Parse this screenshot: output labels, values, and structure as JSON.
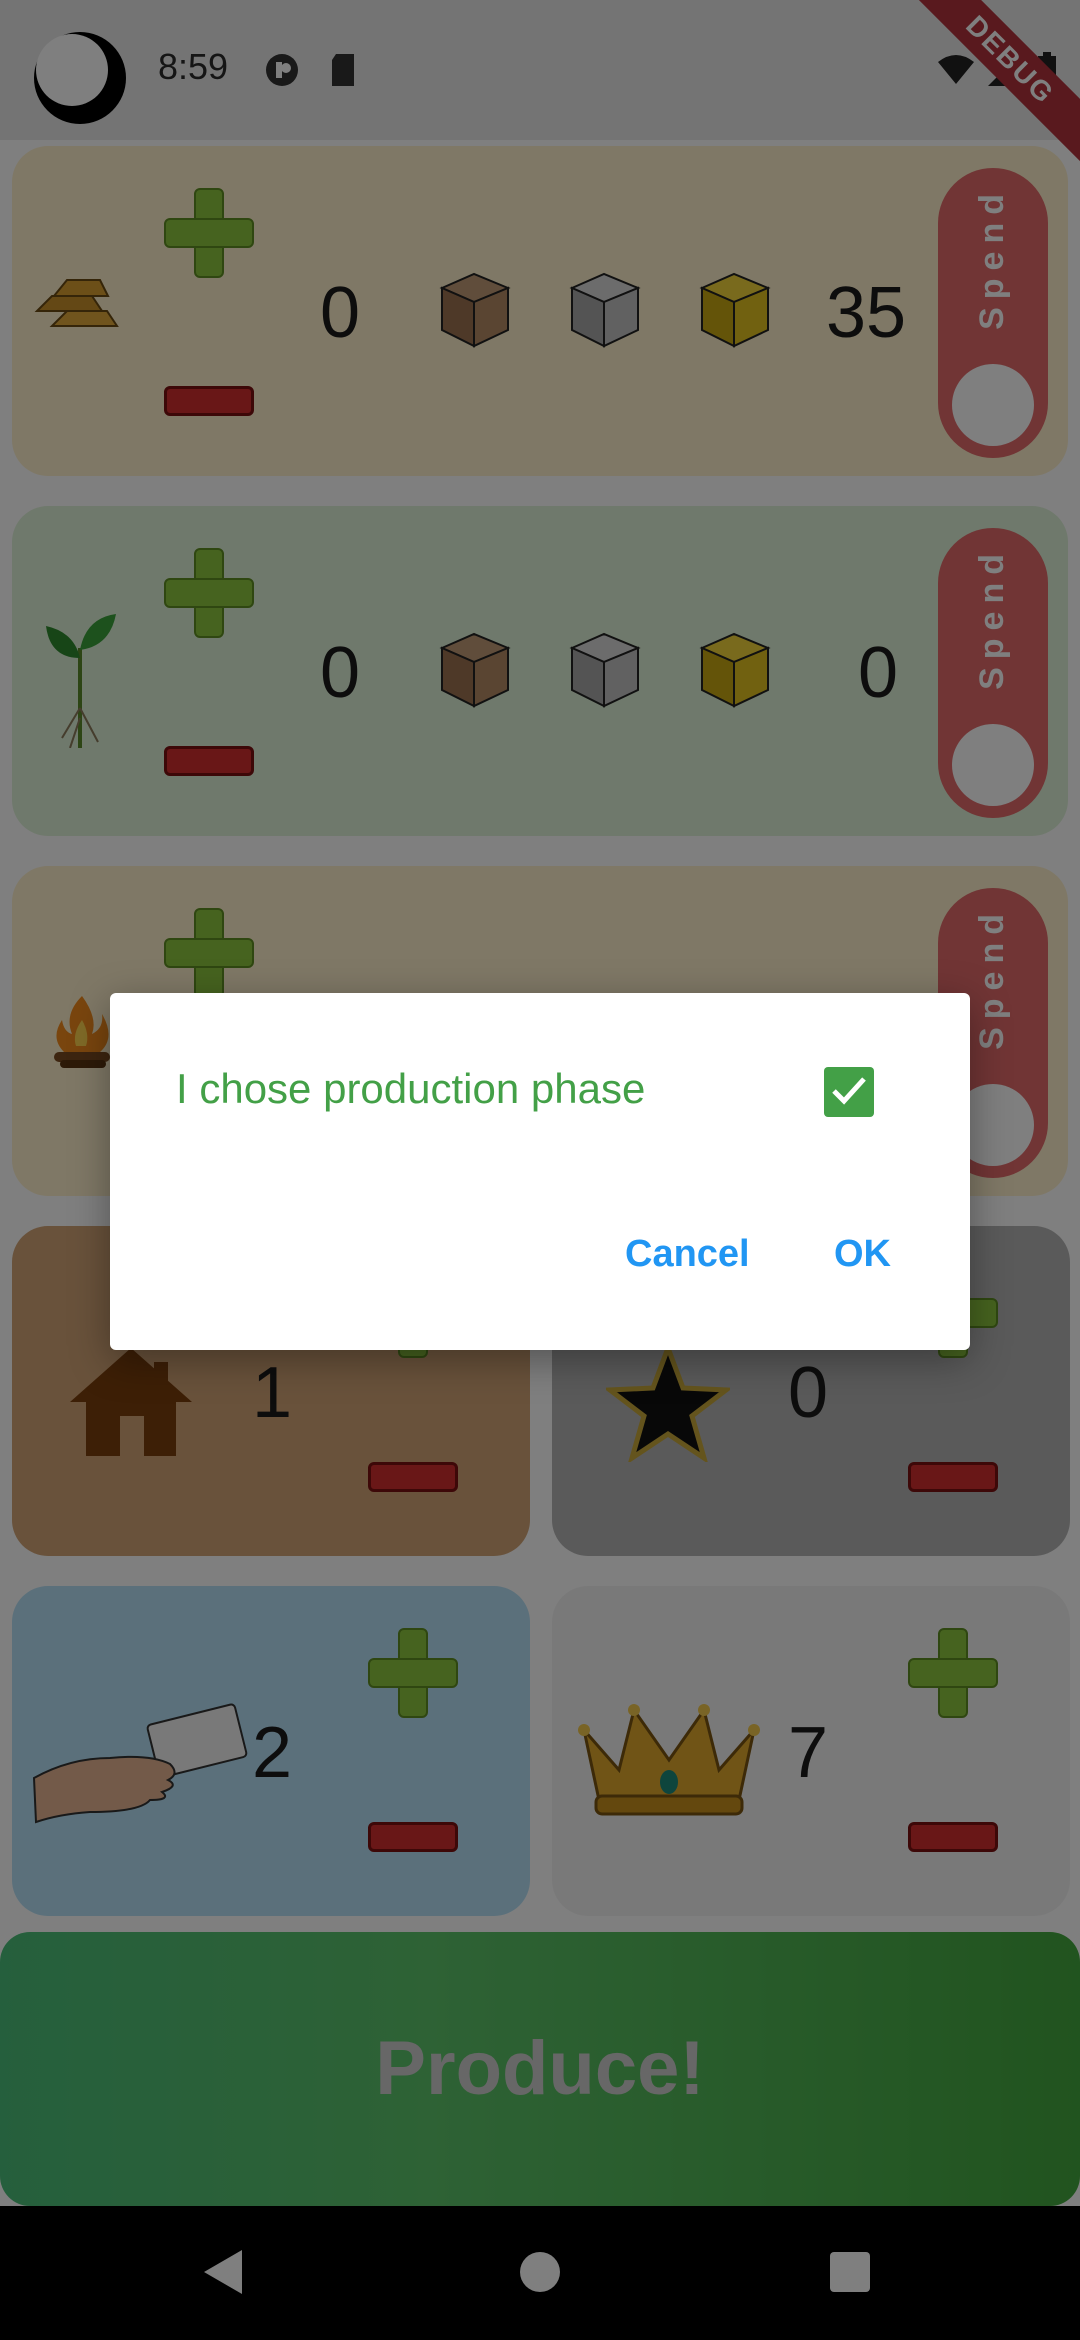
{
  "status_bar": {
    "time": "8:59",
    "debug_label": "DEBUG"
  },
  "resources": [
    {
      "name": "gold",
      "count": "0",
      "produced": "35",
      "toggle_label": "Spend"
    },
    {
      "name": "plant",
      "count": "0",
      "produced": "0",
      "toggle_label": "Spend"
    },
    {
      "name": "energy",
      "toggle_label": "Spend"
    }
  ],
  "counters": {
    "house": "1",
    "star": "0",
    "hand": "2",
    "crown": "7"
  },
  "produce_button": "Produce!",
  "dialog": {
    "message": "I chose production phase",
    "checked": true,
    "cancel_label": "Cancel",
    "ok_label": "OK"
  },
  "colors": {
    "accent_green": "#43a047",
    "dialog_button": "#2196f3",
    "toggle_red": "#e36a6a"
  }
}
